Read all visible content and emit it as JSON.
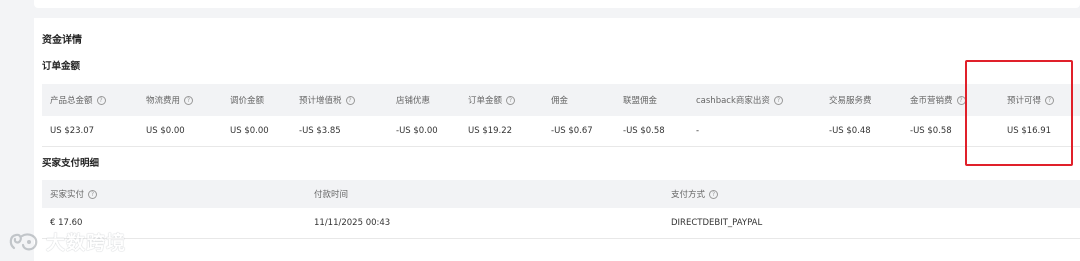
{
  "sections": {
    "funds_title": "资金详情",
    "order_amount_title": "订单金额",
    "buyer_payment_title": "买家支付明细"
  },
  "order_table": {
    "headers": [
      {
        "label": "产品总金额",
        "help": true
      },
      {
        "label": "物流费用",
        "help": true
      },
      {
        "label": "调价金额",
        "help": false
      },
      {
        "label": "预计增值税",
        "help": true
      },
      {
        "label": "店铺优惠",
        "help": false
      },
      {
        "label": "订单金额",
        "help": true
      },
      {
        "label": "佣金",
        "help": false
      },
      {
        "label": "联盟佣金",
        "help": false
      },
      {
        "label": "cashback商家出资",
        "help": true
      },
      {
        "label": "交易服务费",
        "help": false
      },
      {
        "label": "金币营销费",
        "help": true
      },
      {
        "label": "预计可得",
        "help": true
      }
    ],
    "row": [
      "US $23.07",
      "US $0.00",
      "US $0.00",
      "-US $3.85",
      "-US $0.00",
      "US $19.22",
      "-US $0.67",
      "-US $0.58",
      "-",
      "-US $0.48",
      "-US $0.58",
      "US $16.91"
    ]
  },
  "payment_table": {
    "headers": [
      {
        "label": "买家实付",
        "help": true
      },
      {
        "label": "付款时间",
        "help": false
      },
      {
        "label": "支付方式",
        "help": true
      }
    ],
    "row": [
      "€ 17.60",
      "11/11/2025 00:43",
      "DIRECTDEBIT_PAYPAL"
    ]
  },
  "icons": {
    "help": "question-circle-icon"
  },
  "watermark": {
    "text": "大数跨境"
  },
  "colors": {
    "highlight": "#e0202a",
    "header_bg": "#f2f3f5"
  }
}
